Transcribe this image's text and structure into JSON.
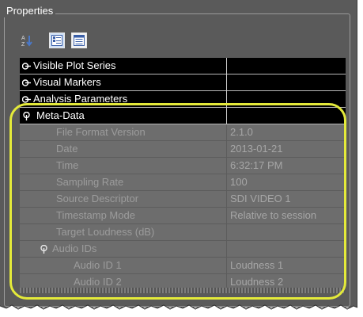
{
  "panel": {
    "title": "Properties",
    "toolbar": [
      {
        "name": "sort-alphabetical-icon",
        "active": false
      },
      {
        "name": "categorized-view-icon",
        "active": true
      },
      {
        "name": "property-pages-icon",
        "active": false
      }
    ]
  },
  "grid": {
    "categories": [
      {
        "label": "Visible Plot Series",
        "expanded": false
      },
      {
        "label": "Visual Markers",
        "expanded": false
      },
      {
        "label": "Analysis Parameters",
        "expanded": false
      },
      {
        "label": "Meta-Data",
        "expanded": true
      }
    ],
    "properties": [
      {
        "label": "File Format Version",
        "value": "2.1.0"
      },
      {
        "label": "Date",
        "value": "2013-01-21"
      },
      {
        "label": "Time",
        "value": "6:32:17 PM"
      },
      {
        "label": "Sampling Rate",
        "value": "100"
      },
      {
        "label": "Source Descriptor",
        "value": "SDI VIDEO 1"
      },
      {
        "label": "Timestamp Mode",
        "value": "Relative to session"
      },
      {
        "label": "Target Loudness (dB)",
        "value": ""
      }
    ],
    "subgroup": {
      "label": "Audio IDs",
      "expanded": true
    },
    "sub_properties": [
      {
        "label": "Audio ID 1",
        "value": "Loudness 1"
      },
      {
        "label": "Audio ID 2",
        "value": "Loudness 2"
      }
    ]
  },
  "colors": {
    "panel_bg": "#5a5a5a",
    "category_bg": "#000000",
    "property_bg": "#6d6d6d",
    "highlight": "#e4ea3a"
  }
}
